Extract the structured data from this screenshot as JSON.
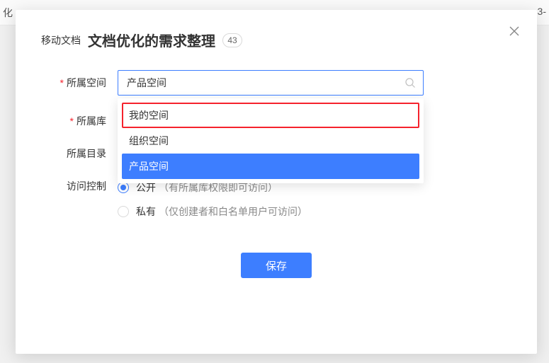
{
  "bg": {
    "left_frag": "化",
    "right_frag": "3-"
  },
  "header": {
    "prefix": "移动文档",
    "title": "文档优化的需求整理",
    "badge": "43"
  },
  "form": {
    "space": {
      "label": "所属空间",
      "required": true,
      "value": "产品空间"
    },
    "library": {
      "label": "所属库",
      "required": true
    },
    "directory": {
      "label": "所属目录",
      "required": false
    },
    "access": {
      "label": "访问控制",
      "options": [
        {
          "label": "公开",
          "desc": "（有所属库权限即可访问）",
          "checked": true
        },
        {
          "label": "私有",
          "desc": "（仅创建者和白名单用户可访问）",
          "checked": false
        }
      ]
    }
  },
  "dropdown": {
    "items": [
      {
        "label": "我的空间",
        "highlighted": true,
        "selected": false
      },
      {
        "label": "组织空间",
        "highlighted": false,
        "selected": false
      },
      {
        "label": "产品空间",
        "highlighted": false,
        "selected": true
      }
    ]
  },
  "actions": {
    "save": "保存"
  }
}
